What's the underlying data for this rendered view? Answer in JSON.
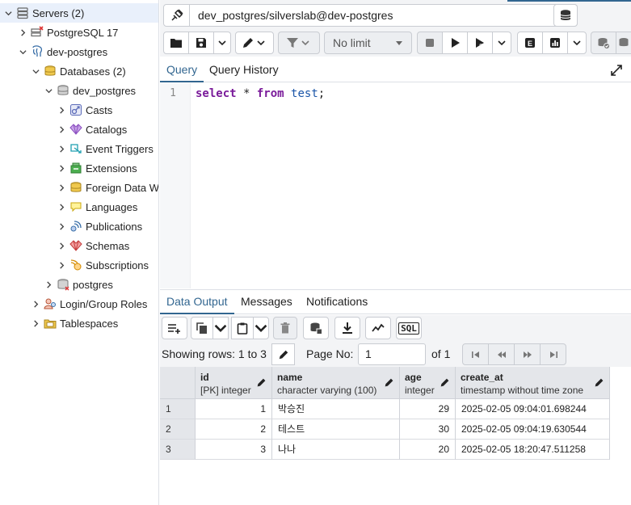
{
  "sidebar": {
    "items": [
      {
        "label": "Servers (2)",
        "icon": "servers-icon",
        "chevron": "down"
      },
      {
        "label": "PostgreSQL 17",
        "icon": "server-disconnected-icon",
        "chevron": "right"
      },
      {
        "label": "dev-postgres",
        "icon": "elephant-icon",
        "chevron": "down"
      },
      {
        "label": "Databases (2)",
        "icon": "databases-icon",
        "chevron": "down"
      },
      {
        "label": "dev_postgres",
        "icon": "database-icon",
        "chevron": "down"
      },
      {
        "label": "Casts",
        "icon": "casts-icon",
        "chevron": "right"
      },
      {
        "label": "Catalogs",
        "icon": "catalogs-icon",
        "chevron": "right"
      },
      {
        "label": "Event Triggers",
        "icon": "event-triggers-icon",
        "chevron": "right"
      },
      {
        "label": "Extensions",
        "icon": "extensions-icon",
        "chevron": "right"
      },
      {
        "label": "Foreign Data W",
        "icon": "foreign-data-icon",
        "chevron": "right"
      },
      {
        "label": "Languages",
        "icon": "languages-icon",
        "chevron": "right"
      },
      {
        "label": "Publications",
        "icon": "publications-icon",
        "chevron": "right"
      },
      {
        "label": "Schemas",
        "icon": "schemas-icon",
        "chevron": "right"
      },
      {
        "label": "Subscriptions",
        "icon": "subscriptions-icon",
        "chevron": "right"
      },
      {
        "label": "postgres",
        "icon": "database-icon",
        "chevron": "right"
      },
      {
        "label": "Login/Group Roles",
        "icon": "roles-icon",
        "chevron": "right"
      },
      {
        "label": "Tablespaces",
        "icon": "tablespaces-icon",
        "chevron": "right"
      }
    ]
  },
  "connection": {
    "label": "dev_postgres/silverslab@dev-postgres"
  },
  "toolbar": {
    "limit_label": "No limit"
  },
  "query_tabs": [
    "Query",
    "Query History"
  ],
  "editor": {
    "line_number": "1",
    "tokens": {
      "kw1": "select",
      "op": " * ",
      "kw2": "from",
      "table": "test",
      "semi": ";"
    }
  },
  "output_tabs": [
    "Data Output",
    "Messages",
    "Notifications"
  ],
  "data_toolbar": {
    "sql_label": "SQL"
  },
  "pager": {
    "showing": "Showing rows: 1 to 3",
    "page_no_label": "Page No:",
    "page_no_value": "1",
    "of_label": "of 1"
  },
  "grid": {
    "columns": [
      {
        "name": "id",
        "type": "[PK] integer"
      },
      {
        "name": "name",
        "type": "character varying (100)"
      },
      {
        "name": "age",
        "type": "integer"
      },
      {
        "name": "create_at",
        "type": "timestamp without time zone"
      }
    ],
    "rows": [
      {
        "n": "1",
        "id": "1",
        "name": "박승진",
        "age": "29",
        "create_at": "2025-02-05 09:04:01.698244"
      },
      {
        "n": "2",
        "id": "2",
        "name": "테스트",
        "age": "30",
        "create_at": "2025-02-05 09:04:19.630544"
      },
      {
        "n": "3",
        "id": "3",
        "name": "나나",
        "age": "20",
        "create_at": "2025-02-05 18:20:47.511258"
      }
    ]
  },
  "colors": {
    "accent": "#326690",
    "keyword": "#7a1b9a",
    "identifier": "#1a55a8"
  }
}
